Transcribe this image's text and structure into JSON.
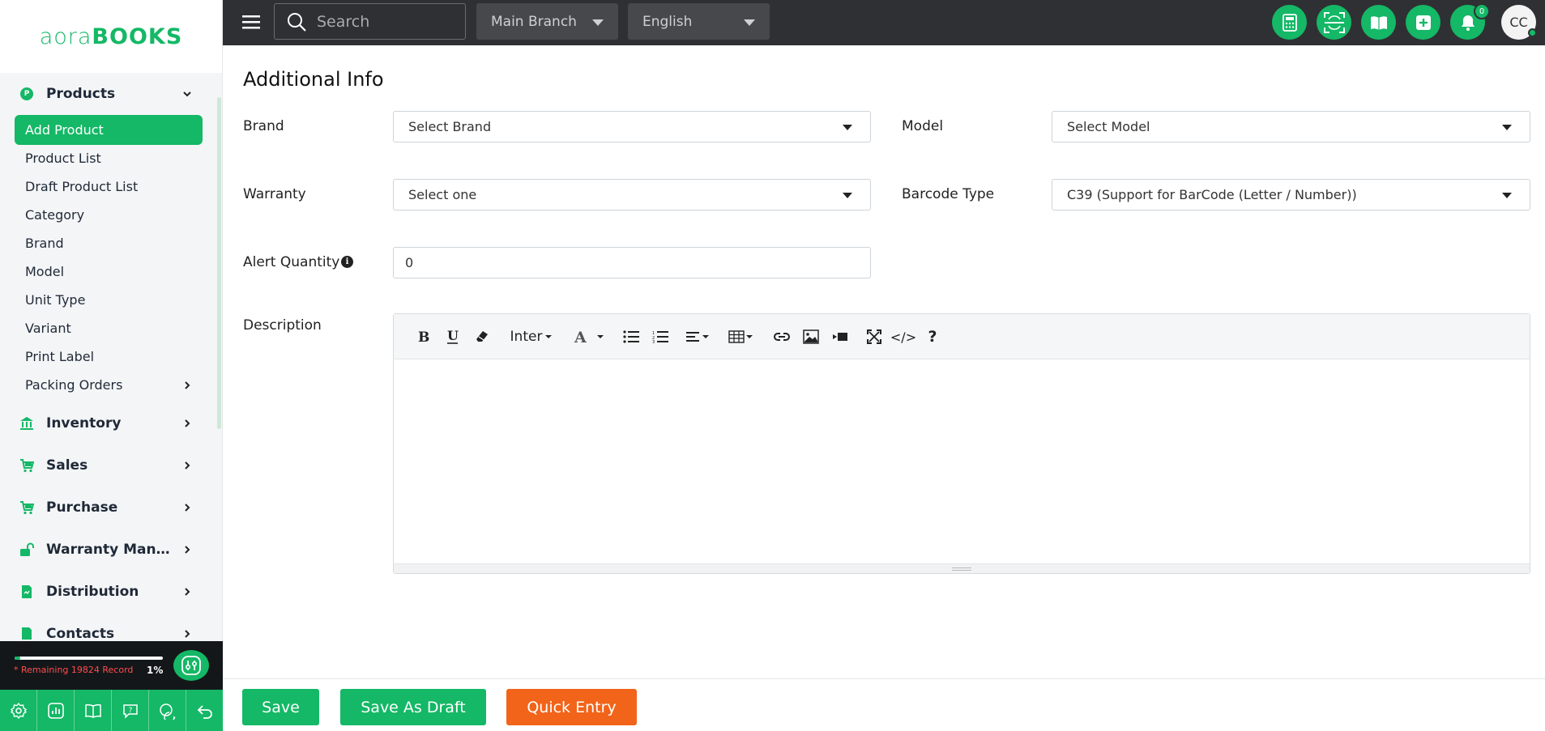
{
  "app": {
    "logo_part1": "aora",
    "logo_part2": "BOOKS"
  },
  "colors": {
    "brand_green": "#14b866",
    "topbar_bg": "#2f3033",
    "quick_entry_orange": "#f26419",
    "remaining_red": "#ff4d4f"
  },
  "sidebar": {
    "products": {
      "label": "Products",
      "icon": "products-circle-icon",
      "badge_letter": "P"
    },
    "sub_items": [
      {
        "label": "Add Product",
        "active": true
      },
      {
        "label": "Product List"
      },
      {
        "label": "Draft Product List"
      },
      {
        "label": "Category"
      },
      {
        "label": "Brand"
      },
      {
        "label": "Model"
      },
      {
        "label": "Unit Type"
      },
      {
        "label": "Variant"
      },
      {
        "label": "Print Label"
      },
      {
        "label": "Packing Orders",
        "has_submenu": true
      }
    ],
    "groups": [
      {
        "label": "Inventory",
        "icon": "bank-icon"
      },
      {
        "label": "Sales",
        "icon": "cart-icon"
      },
      {
        "label": "Purchase",
        "icon": "cart-icon"
      },
      {
        "label": "Warranty Manage...",
        "icon": "unlock-icon"
      },
      {
        "label": "Distribution",
        "icon": "document-icon"
      },
      {
        "label": "Contacts",
        "icon": "document-icon"
      }
    ],
    "record": {
      "remaining_text": "* Remaining 19824 Record",
      "percent_text": "1%",
      "percent": 0.01
    },
    "bottom_icons": [
      "settings-icon",
      "chart-icon",
      "book-icon",
      "help-icon",
      "chat-icon",
      "back-icon"
    ]
  },
  "topbar": {
    "search_placeholder": "Search",
    "branch": "Main Branch",
    "language": "English",
    "notification_count": "0",
    "avatar_initials": "CC",
    "icons": [
      "calculator-icon",
      "scan-icon",
      "book-open-icon",
      "plus-square-icon",
      "bell-icon"
    ]
  },
  "form": {
    "title": "Additional Info",
    "brand_label": "Brand",
    "brand_value": "Select Brand",
    "model_label": "Model",
    "model_value": "Select Model",
    "warranty_label": "Warranty",
    "warranty_value": "Select one",
    "barcode_label": "Barcode Type",
    "barcode_value": "C39 (Support for BarCode (Letter / Number))",
    "alert_label": "Alert Quantity",
    "alert_value": "0",
    "description_label": "Description",
    "editor": {
      "font_name": "Inter",
      "code_label": "</>",
      "help_label": "?"
    }
  },
  "footer": {
    "save": "Save",
    "save_draft": "Save As Draft",
    "quick_entry": "Quick Entry"
  }
}
